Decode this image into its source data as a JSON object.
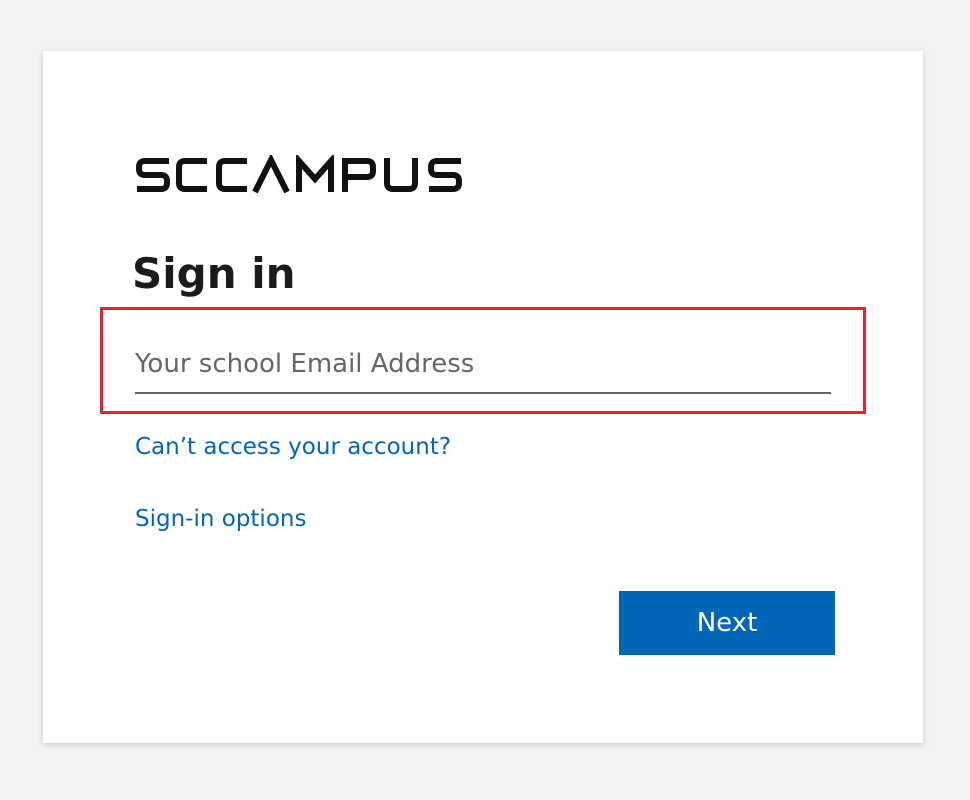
{
  "brand": {
    "logo_text": "SCCAMPUS"
  },
  "signin": {
    "title": "Sign in",
    "email_placeholder": "Your school Email Address",
    "email_value": ""
  },
  "links": {
    "cant_access": "Can’t access your account?",
    "signin_options": "Sign-in options"
  },
  "actions": {
    "next_label": "Next"
  },
  "colors": {
    "page_background": "#f2f3f5",
    "card_background": "#ffffff",
    "link": "#0067b8",
    "primary_button": "#0067b8",
    "highlight_box": "#e8232f",
    "title_text": "#1b1b1b"
  }
}
